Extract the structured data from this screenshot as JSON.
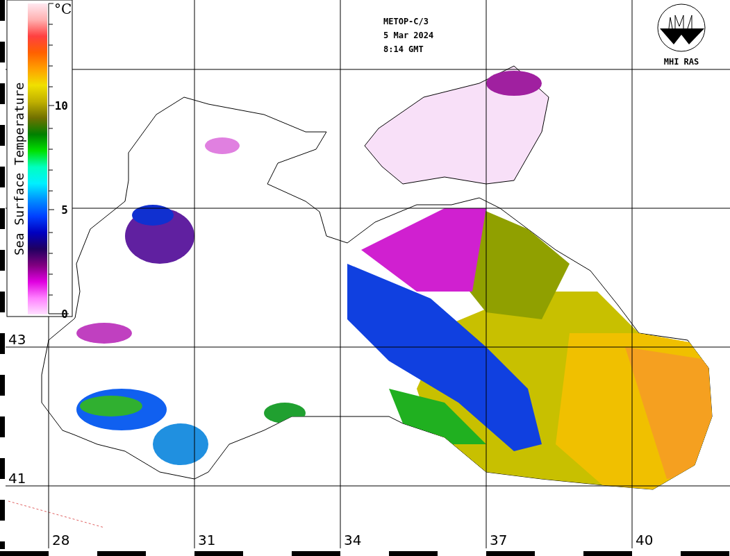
{
  "header": {
    "satellite": "METOP-C/3",
    "date": "5 Mar 2024",
    "time": "8:14 GMT"
  },
  "logo": {
    "label": "MHI RAS"
  },
  "colorbar": {
    "title": "Sea Surface Temperature",
    "unit": "°C",
    "ticks": [
      "10",
      "5",
      "0"
    ]
  },
  "grid": {
    "lat_labels": [
      "43",
      "41"
    ],
    "lon_labels": [
      "28",
      "31",
      "34",
      "37",
      "40"
    ]
  }
}
